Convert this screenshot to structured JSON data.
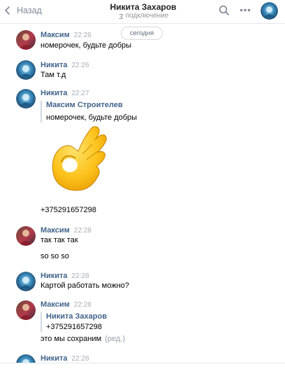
{
  "header": {
    "back_label": "Назад",
    "title": "Никита Захаров",
    "status": "подключение"
  },
  "chat": {
    "date": "сегодня",
    "messages": [
      {
        "author": "Максим",
        "time": "22:26",
        "lines": [
          "номерочек, будьте добры"
        ]
      },
      {
        "author": "Никита",
        "time": "22:26",
        "lines": [
          "Там т.д"
        ]
      },
      {
        "author": "Никита",
        "time": "22:27",
        "quote": {
          "author": "Максим Строителев",
          "text": "номерочек, будьте добры"
        },
        "sticker": "ok-hand-sticker",
        "lines": [
          "+375291657298"
        ]
      },
      {
        "author": "Максим",
        "time": "22:28",
        "lines": [
          "так так так",
          "so so so"
        ]
      },
      {
        "author": "Никита",
        "time": "22:28",
        "lines": [
          "Картой работать можно?"
        ]
      },
      {
        "author": "Максим",
        "time": "22:28",
        "quote": {
          "author": "Никита Захаров",
          "text": "+375291657298"
        },
        "lines": [
          "это мы сохраним"
        ],
        "edited": "(ред.)"
      },
      {
        "author": "Никита",
        "time": "22:28",
        "lines": []
      }
    ]
  },
  "colors": {
    "name": "#42648b",
    "time": "#a6aeb8",
    "accent": "#5181b8"
  },
  "icons": [
    "chevron-left-icon",
    "spinner-icon",
    "search-icon",
    "more-icon",
    "ok-hand-sticker"
  ]
}
